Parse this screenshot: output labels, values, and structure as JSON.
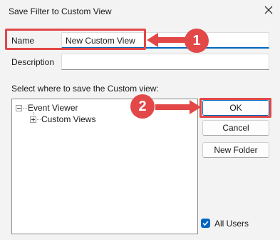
{
  "window": {
    "title": "Save Filter to Custom View"
  },
  "icons": {
    "close": "close-icon",
    "tree_expander_open": "tree-collapse-icon",
    "tree_expander_closed": "tree-expand-icon",
    "checkmark": "checkmark-icon",
    "arrow": "arrow-left-icon"
  },
  "form": {
    "name_label": "Name",
    "name_value": "New Custom View",
    "description_label": "Description",
    "description_value": "",
    "location_label": "Select where to save the Custom view:"
  },
  "tree": {
    "root": "Event Viewer",
    "children": [
      "Custom Views"
    ]
  },
  "buttons": {
    "ok": "OK",
    "cancel": "Cancel",
    "new_folder": "New Folder"
  },
  "all_users": {
    "label": "All Users",
    "checked": true
  },
  "annotations": [
    {
      "number": "1"
    },
    {
      "number": "2"
    }
  ],
  "colors": {
    "accent": "#0067c0",
    "annotation": "#e24848",
    "background": "#f3f3f3"
  }
}
